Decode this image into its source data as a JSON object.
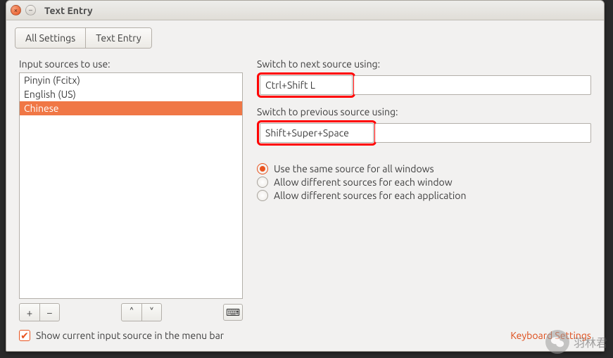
{
  "window": {
    "title": "Text Entry"
  },
  "breadcrumb": {
    "all_settings": "All Settings",
    "text_entry": "Text Entry"
  },
  "left": {
    "label": "Input sources to use:",
    "items": [
      {
        "label": "Pinyin (Fcitx)",
        "selected": false
      },
      {
        "label": "English (US)",
        "selected": false
      },
      {
        "label": "Chinese",
        "selected": true
      }
    ]
  },
  "toolbar": {
    "add": "+",
    "remove": "−",
    "move_up": "˄",
    "move_down": "˅",
    "keyboard": "⌨"
  },
  "right": {
    "next_label": "Switch to next source using:",
    "next_value": "Ctrl+Shift L",
    "prev_label": "Switch to previous source using:",
    "prev_value": "Shift+Super+Space",
    "radio_options": [
      {
        "label": "Use the same source for all windows",
        "checked": true
      },
      {
        "label": "Allow different sources for each window",
        "checked": false
      },
      {
        "label": "Allow different sources for each application",
        "checked": false
      }
    ]
  },
  "bottom": {
    "show_in_menu": "Show current input source in the menu bar",
    "show_in_menu_checked": true,
    "keyboard_settings": "Keyboard Settings"
  },
  "watermark": {
    "text": "羽林君"
  }
}
